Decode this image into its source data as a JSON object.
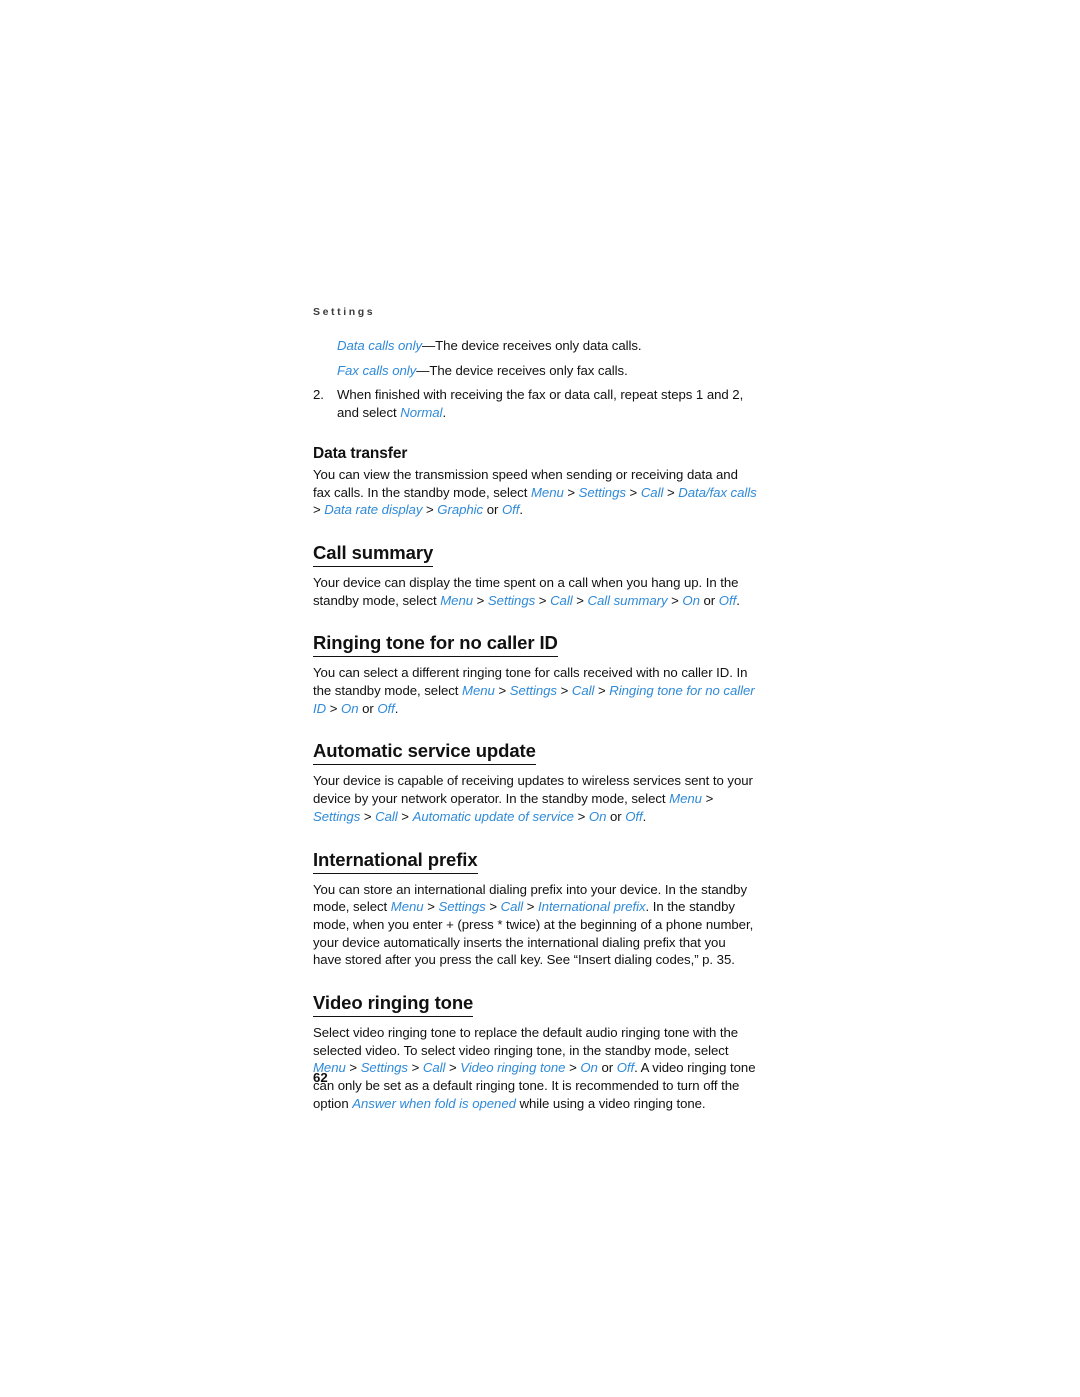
{
  "page": {
    "running_header": "Settings",
    "page_number": "62"
  },
  "colors": {
    "menu_path_blue": "#2f8ad8",
    "body_text": "#111111",
    "header_gray": "#3c3c3c",
    "background": "#ffffff"
  },
  "definitions": [
    {
      "term": "Data calls only",
      "dash": "—",
      "description": "The device receives only data calls."
    },
    {
      "term": "Fax calls only",
      "dash": "—",
      "description": "The device receives only fax calls."
    }
  ],
  "numbered_item": {
    "number": "2.",
    "text_before": "When finished with receiving the fax or data call, repeat steps 1 and 2, and select ",
    "menu_value": "Normal",
    "text_after": "."
  },
  "sections": [
    {
      "id": "data-transfer",
      "level": "h3",
      "title": "Data transfer",
      "paragraph": {
        "part1": "You can view the transmission speed when sending or receiving data and fax calls. In the standby mode, select ",
        "path": [
          "Menu",
          "Settings",
          "Call",
          "Data/fax calls",
          "Data rate display",
          "Graphic"
        ],
        "mid": " or ",
        "last": "Off",
        "end": "."
      }
    },
    {
      "id": "call-summary",
      "level": "h2",
      "title": "Call summary",
      "paragraph": {
        "part1": "Your device can display the time spent on a call when you hang up. In the standby mode, select ",
        "path": [
          "Menu",
          "Settings",
          "Call",
          "Call summary",
          "On"
        ],
        "mid": " or ",
        "last": "Off",
        "end": "."
      }
    },
    {
      "id": "ringing-tone-no-caller-id",
      "level": "h2",
      "title": "Ringing tone for no caller ID",
      "paragraph": {
        "part1": "You can select a different ringing tone for calls received with no caller ID. In the standby mode, select ",
        "path": [
          "Menu",
          "Settings",
          "Call",
          "Ringing tone for no caller ID",
          "On"
        ],
        "mid": " or ",
        "last": "Off",
        "end": "."
      }
    },
    {
      "id": "automatic-service-update",
      "level": "h2",
      "title": "Automatic service update",
      "paragraph": {
        "part1": "Your device is capable of receiving updates to wireless services sent to your device by your network operator. In the standby mode, select ",
        "path": [
          "Menu",
          "Settings",
          "Call",
          "Automatic update of service",
          "On"
        ],
        "mid": " or ",
        "last": "Off",
        "end": "."
      }
    },
    {
      "id": "international-prefix",
      "level": "h2",
      "title": "International prefix",
      "paragraph": {
        "part1": "You can store an international dialing prefix into your device. In the standby mode, select ",
        "path": [
          "Menu",
          "Settings",
          "Call",
          "International prefix"
        ],
        "end": ". In the standby mode, when you enter + (press * twice) at the beginning of a phone number, your device automatically inserts the international dialing prefix that you have stored after you press the call key. See “Insert dialing codes,” p. 35."
      }
    },
    {
      "id": "video-ringing-tone",
      "level": "h2",
      "title": "Video ringing tone",
      "paragraph": {
        "part1": "Select video ringing tone to replace the default audio ringing tone with the selected video. To select video ringing tone, in the standby mode, select ",
        "path": [
          "Menu",
          "Settings",
          "Call",
          "Video ringing tone",
          "On"
        ],
        "mid": " or ",
        "last": "Off",
        "end": ". A video ringing tone can only be set as a default ringing tone. It is recommended to turn off the option ",
        "option": "Answer when fold is opened",
        "tail": " while using a video ringing tone."
      }
    }
  ],
  "separator": " > "
}
